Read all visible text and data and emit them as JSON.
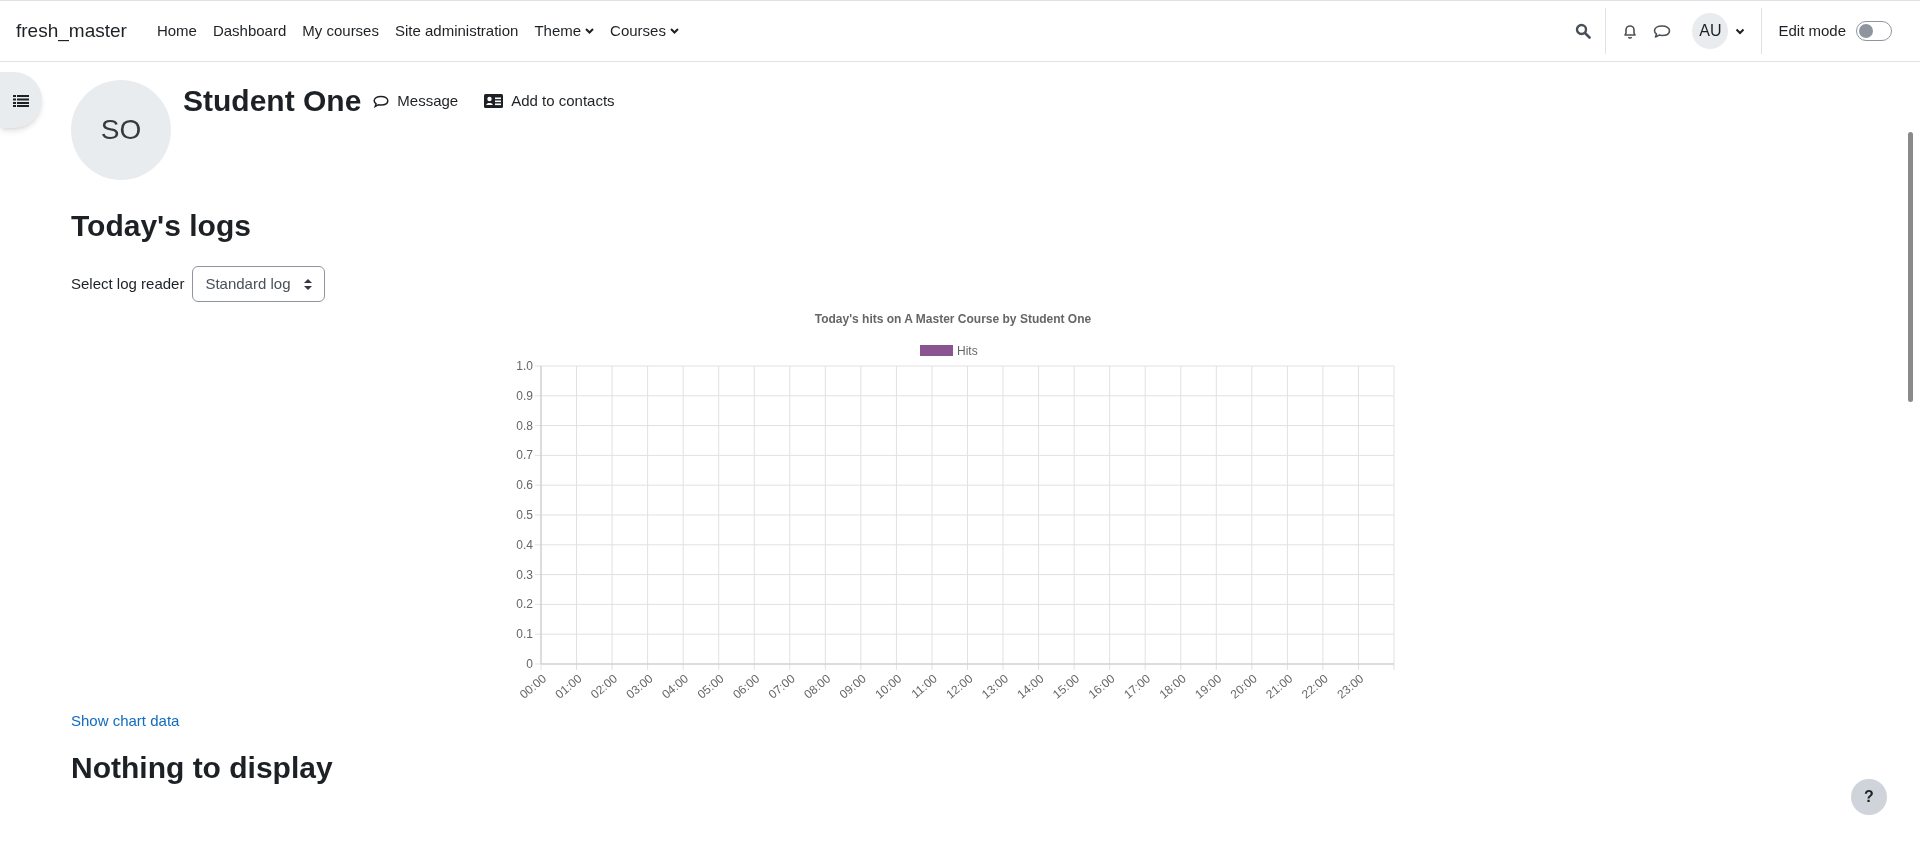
{
  "navbar": {
    "brand": "fresh_master",
    "items": [
      {
        "label": "Home",
        "dropdown": false
      },
      {
        "label": "Dashboard",
        "dropdown": false
      },
      {
        "label": "My courses",
        "dropdown": false
      },
      {
        "label": "Site administration",
        "dropdown": false
      },
      {
        "label": "Theme",
        "dropdown": true
      },
      {
        "label": "Courses",
        "dropdown": true
      }
    ],
    "user_initials": "AU",
    "edit_mode": {
      "label": "Edit mode",
      "on": false
    }
  },
  "profile": {
    "initials": "SO",
    "name": "Student One",
    "actions": [
      {
        "kind": "message",
        "label": "Message"
      },
      {
        "kind": "contact",
        "label": "Add to contacts"
      }
    ]
  },
  "heading": "Today's logs",
  "log_reader": {
    "label": "Select log reader",
    "value": "Standard log"
  },
  "chart_data": {
    "type": "bar",
    "title": "Today's hits on A Master Course by Student One",
    "categories": [
      "00:00",
      "01:00",
      "02:00",
      "03:00",
      "04:00",
      "05:00",
      "06:00",
      "07:00",
      "08:00",
      "09:00",
      "10:00",
      "11:00",
      "12:00",
      "13:00",
      "14:00",
      "15:00",
      "16:00",
      "17:00",
      "18:00",
      "19:00",
      "20:00",
      "21:00",
      "22:00",
      "23:00"
    ],
    "series": [
      {
        "name": "Hits",
        "color": "#8a5491",
        "values": [
          0,
          0,
          0,
          0,
          0,
          0,
          0,
          0,
          0,
          0,
          0,
          0,
          0,
          0,
          0,
          0,
          0,
          0,
          0,
          0,
          0,
          0,
          0,
          0
        ]
      }
    ],
    "ylim": [
      0,
      1
    ],
    "grid": true,
    "yticks": [
      0,
      0.1,
      0.2,
      0.3,
      0.4,
      0.5,
      0.6,
      0.7,
      0.8,
      0.9,
      {
        "value": 1,
        "label": "1.0"
      }
    ]
  },
  "show_chart_data": "Show chart data",
  "empty_heading": "Nothing to display",
  "help_button": "?"
}
